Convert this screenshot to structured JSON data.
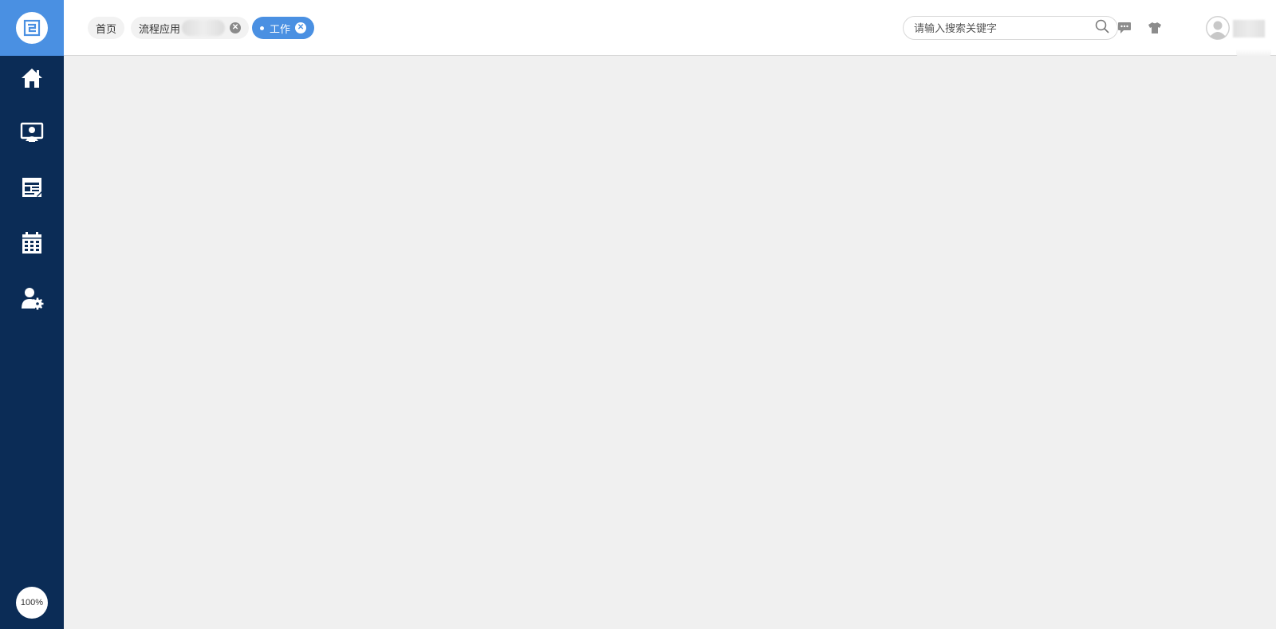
{
  "sidebar": {
    "logo_icon": "logo-icon",
    "items": [
      {
        "name": "home",
        "icon": "home-icon"
      },
      {
        "name": "desktop-user",
        "icon": "monitor-user-icon"
      },
      {
        "name": "news",
        "icon": "newspaper-icon"
      },
      {
        "name": "calendar",
        "icon": "calendar-icon"
      },
      {
        "name": "user-settings",
        "icon": "user-gear-icon"
      }
    ],
    "zoom_label": "100%"
  },
  "header": {
    "tabs": [
      {
        "label": "首页",
        "closable": false,
        "active": false
      },
      {
        "label": "流程应用",
        "closable": true,
        "active": false
      },
      {
        "label": "工作",
        "closable": true,
        "active": true
      }
    ],
    "search": {
      "placeholder": "请输入搜索关键字",
      "value": ""
    },
    "icons": [
      "message-icon",
      "skin-shirt-icon"
    ]
  },
  "colors": {
    "sidebar_bg": "#0b2c56",
    "accent": "#4a90e2",
    "content_bg": "#f0f0f0"
  }
}
